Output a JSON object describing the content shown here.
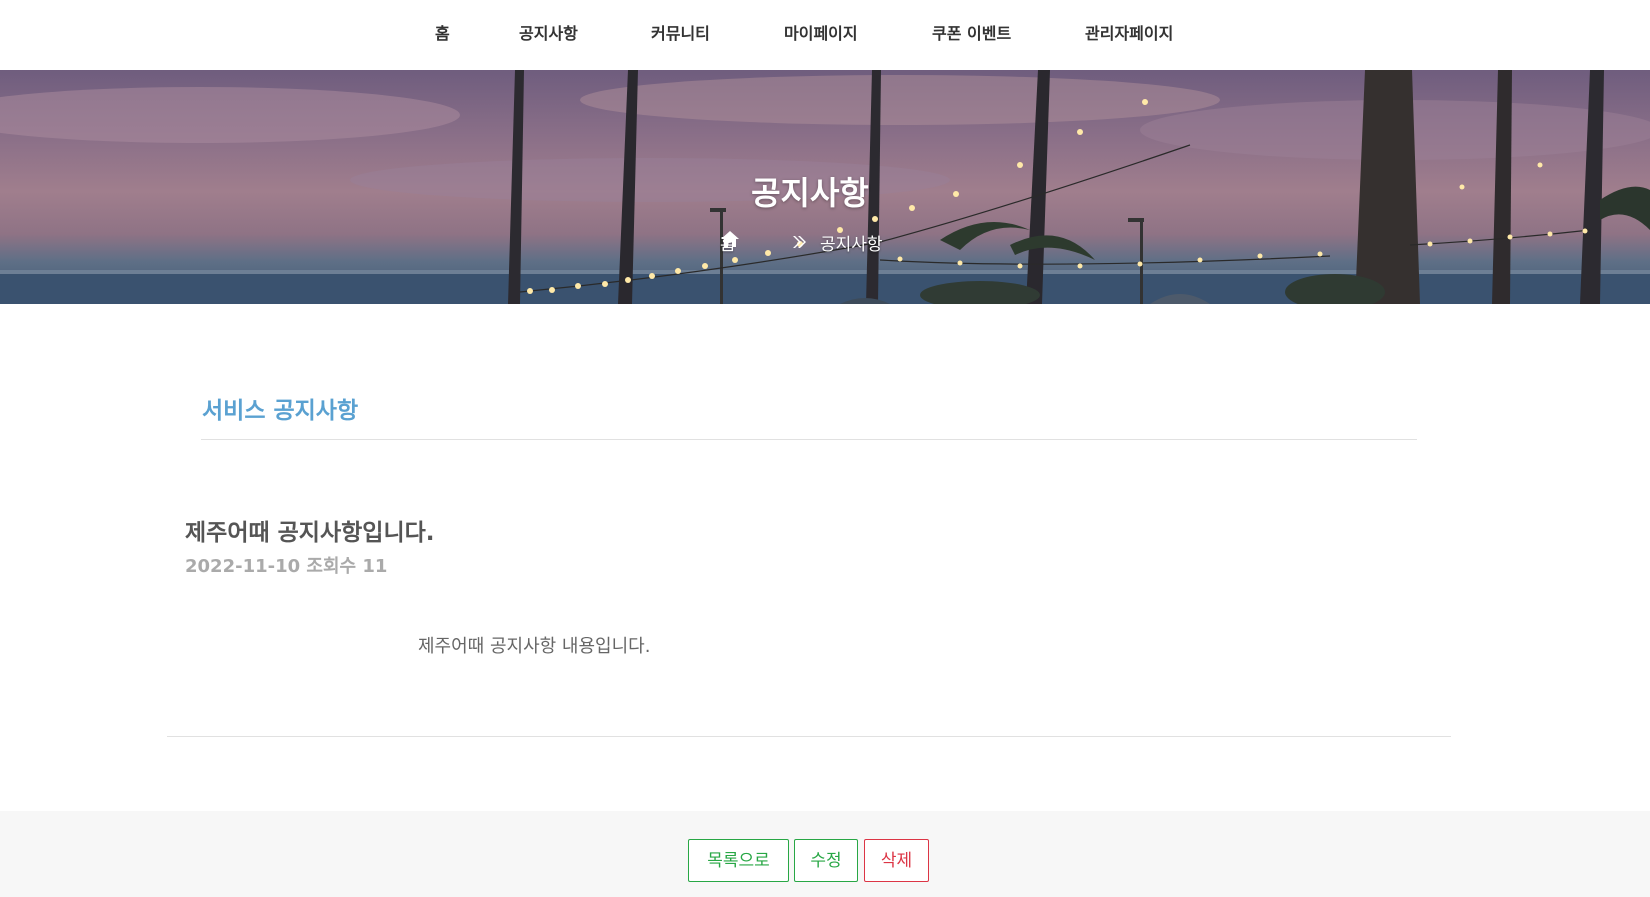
{
  "nav": {
    "items": [
      "홈",
      "공지사항",
      "커뮤니티",
      "마이페이지",
      "쿠폰 이벤트",
      "관리자페이지"
    ]
  },
  "hero": {
    "title": "공지사항",
    "breadcrumb_home": "홈",
    "breadcrumb_current": "공지사항"
  },
  "section": {
    "title": "서비스 공지사항"
  },
  "post": {
    "title": "제주어때 공지사항입니다.",
    "meta": "2022-11-10 조회수 11",
    "body": "제주어때 공지사항 내용입니다."
  },
  "buttons": {
    "list": "목록으로",
    "edit": "수정",
    "delete": "삭제"
  },
  "colors": {
    "accent_blue": "#5aa1d1",
    "button_green": "#28a745",
    "button_red": "#dc3545"
  },
  "icons": [
    "home-icon",
    "double-chevron-right-icon"
  ]
}
